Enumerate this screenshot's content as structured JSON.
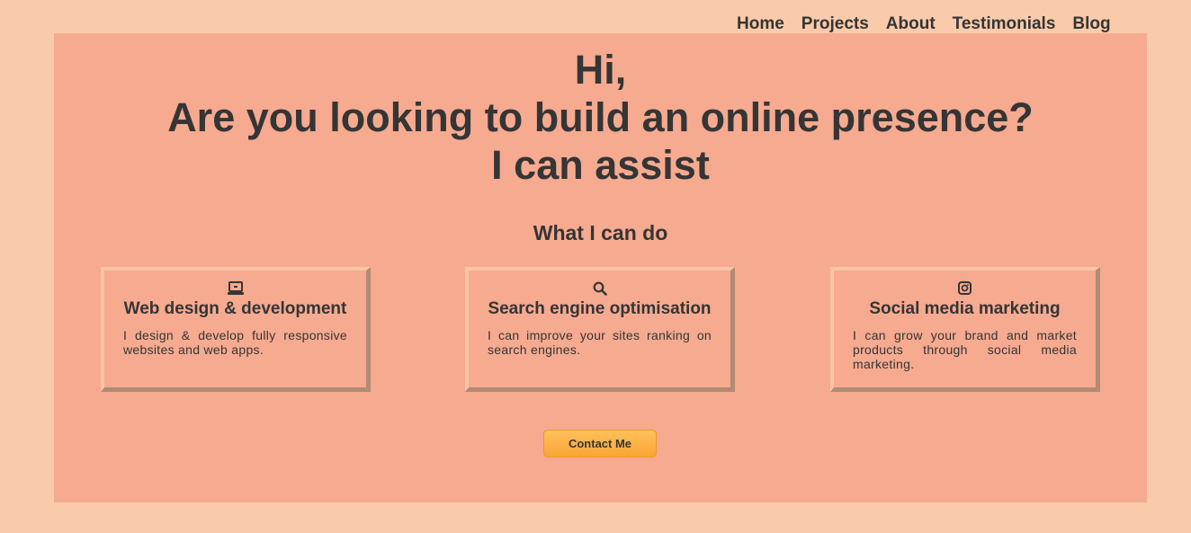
{
  "nav": {
    "items": [
      {
        "label": "Home"
      },
      {
        "label": "Projects"
      },
      {
        "label": "About"
      },
      {
        "label": "Testimonials"
      },
      {
        "label": "Blog"
      }
    ]
  },
  "hero": {
    "headline_line1": "Hi,",
    "headline_line2": "Are you looking to build an online presence?",
    "headline_line3": "I can assist"
  },
  "services": {
    "heading": "What I can do",
    "items": [
      {
        "icon": "laptop-icon",
        "title": "Web design & development",
        "description": "I design & develop fully responsive websites and web apps."
      },
      {
        "icon": "search-icon",
        "title": "Search engine optimisation",
        "description": "I can improve your sites ranking on search engines."
      },
      {
        "icon": "instagram-icon",
        "title": "Social media marketing",
        "description": "I can grow your brand and market products through social media marketing."
      }
    ]
  },
  "contact": {
    "button_label": "Contact Me"
  },
  "colors": {
    "page_background": "#f9cbab",
    "hero_background": "#f6aa90",
    "text": "#353535",
    "button": "#fbb03f"
  }
}
